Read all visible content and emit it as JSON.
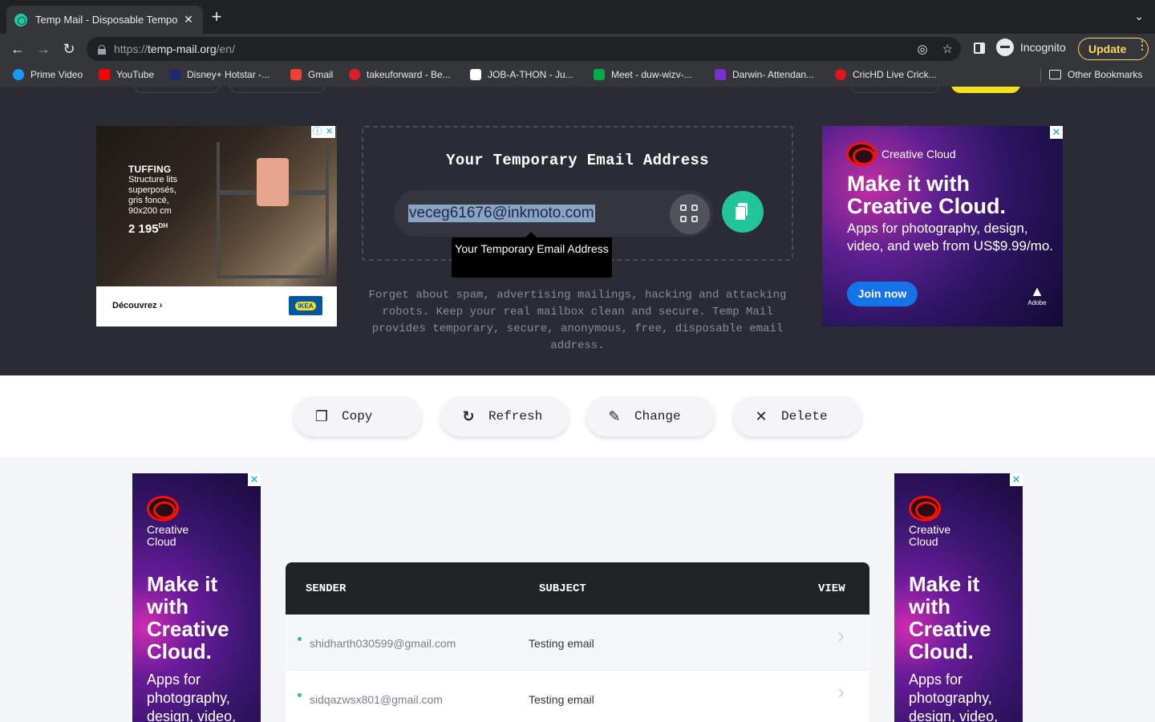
{
  "browser": {
    "tab_title": "Temp Mail - Disposable Tempo",
    "tab_close": "✕",
    "url_scheme": "https://",
    "url_host": "temp-mail.org",
    "url_path": "/en/",
    "incognito_label": "Incognito",
    "update_label": "Update",
    "bookmarks": [
      {
        "label": "Prime Video",
        "color": "#1a98ff"
      },
      {
        "label": "YouTube",
        "color": "#ff0000"
      },
      {
        "label": "Disney+ Hotstar -...",
        "color": "#1f2a6b"
      },
      {
        "label": "Gmail",
        "color": "#ea4335"
      },
      {
        "label": "takeuforward - Be...",
        "color": "#e11d2a"
      },
      {
        "label": "JOB-A-THON - Ju...",
        "color": "#ffffff"
      },
      {
        "label": "Meet - duw-wizv-...",
        "color": "#00ac47"
      },
      {
        "label": "Darwin- Attendan...",
        "color": "#7b2fd1"
      },
      {
        "label": "CricHD Live Crick...",
        "color": "#e0141c"
      }
    ],
    "other_bookmarks": "Other Bookmarks"
  },
  "ads": {
    "ikea": {
      "heading": "TUFFING",
      "lines": [
        "Structure lits",
        "superposés,",
        "gris foncé,",
        "90x200 cm"
      ],
      "price": "2 195",
      "price_unit": "DH",
      "cta": "Découvrez",
      "logo": "IKEA"
    },
    "creative_cloud": {
      "brand": "Creative Cloud",
      "headline_1": "Make it with",
      "headline_2": "Creative Cloud.",
      "sub": "Apps for photography, design, video, and web from US$9.99/mo.",
      "cta": "Join now",
      "adobe": "Adobe"
    },
    "skyscraper": {
      "brand_1": "Creative",
      "brand_2": "Cloud",
      "headline": [
        "Make it",
        "with",
        "Creative",
        "Cloud."
      ],
      "sub": [
        "Apps for",
        "photography,",
        "design, video,"
      ]
    }
  },
  "email": {
    "title": "Your Temporary Email Address",
    "address": "veceg61676@inkmoto.com",
    "tooltip": "Your Temporary Email Address",
    "description": "Forget about spam, advertising mailings, hacking and attacking robots. Keep your real mailbox clean and secure. Temp Mail provides temporary, secure, anonymous, free, disposable email address."
  },
  "actions": {
    "copy": "Copy",
    "refresh": "Refresh",
    "change": "Change",
    "delete": "Delete"
  },
  "inbox": {
    "columns": {
      "sender": "SENDER",
      "subject": "SUBJECT",
      "view": "VIEW"
    },
    "rows": [
      {
        "sender": "shidharth030599@gmail.com",
        "subject": "Testing email"
      },
      {
        "sender": "sidqazwsx801@gmail.com",
        "subject": "Testing email"
      }
    ]
  }
}
